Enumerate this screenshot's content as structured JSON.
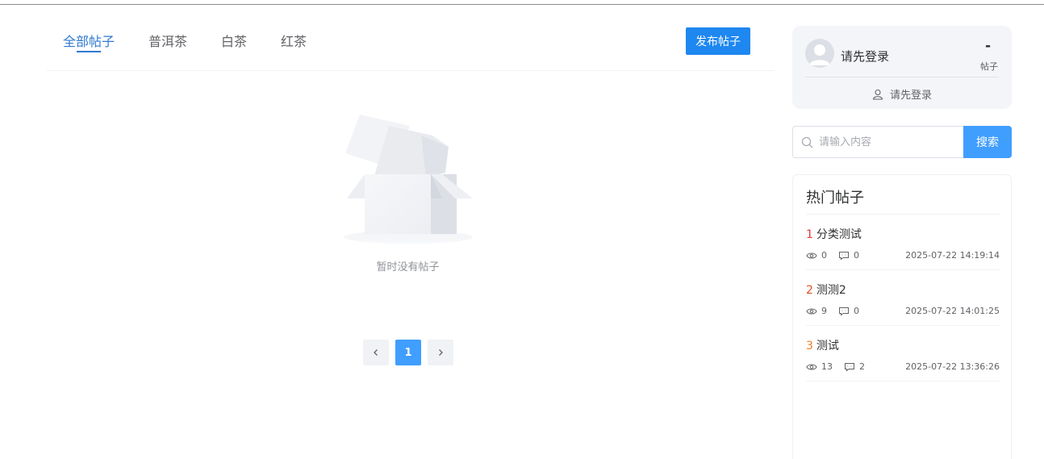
{
  "tabs": [
    {
      "label": "全部帖子"
    },
    {
      "label": "普洱茶"
    },
    {
      "label": "白茶"
    },
    {
      "label": "红茶"
    }
  ],
  "post_button_label": "发布帖子",
  "empty_text": "暂时没有帖子",
  "pagination": {
    "current_page": "1",
    "prev_icon": "chevron-left-icon",
    "next_icon": "chevron-right-icon"
  },
  "user_card": {
    "name": "请先登录",
    "post_count": "-",
    "post_count_label": "帖子",
    "login_link": "请先登录"
  },
  "search": {
    "placeholder": "请输入内容",
    "button_label": "搜索"
  },
  "hot_posts": {
    "title": "热门帖子",
    "items": [
      {
        "rank": "1",
        "title": "分类测试",
        "views": "0",
        "comments": "0",
        "time": "2025-07-22 14:19:14"
      },
      {
        "rank": "2",
        "title": "测测2",
        "views": "9",
        "comments": "0",
        "time": "2025-07-22 14:01:25"
      },
      {
        "rank": "3",
        "title": "测试",
        "views": "13",
        "comments": "2",
        "time": "2025-07-22 13:36:26"
      }
    ]
  },
  "colors": {
    "accent": "#409eff",
    "tab_active": "#2f7ad1",
    "rank_1": "#e53935",
    "rank_2": "#e0502a",
    "rank_3": "#f07c26"
  }
}
